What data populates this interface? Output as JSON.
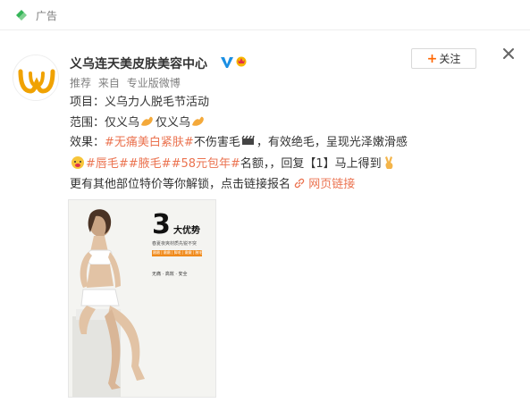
{
  "ad_bar": {
    "label": "广告"
  },
  "post": {
    "account_name": "义乌连天美皮肤美容中心",
    "meta": [
      "推荐",
      "来自",
      "专业版微博"
    ],
    "follow_label": "关注",
    "lines": {
      "l1": "项目：义乌力人脱毛节活动",
      "l2_prefix": "范围：仅义乌",
      "l2_mid": "仅义乌",
      "l3_prefix": "效果：",
      "l3_tag1": "#无痛美白紧肤#",
      "l3_mid": "不伤害毛",
      "l3_suffix": "，有效绝毛，呈现光泽嫩滑感",
      "l4_tag": "#唇毛##腋毛##58元包年#",
      "l4_mid": "名额，，回复【1】马上得到",
      "l5_text": "更有其他部位特价等你解锁，点击链接报名",
      "l5_link": "网页链接"
    },
    "image": {
      "number": "3",
      "title": "大优势",
      "subtitle": "春夏夜爽材质先锐不突",
      "bar_text": "嫩嫩 | 嫩嫩 | 脚毛 | 嫩嫩 | 腋毛",
      "features": "无痛 · 高效 · 安全"
    }
  }
}
